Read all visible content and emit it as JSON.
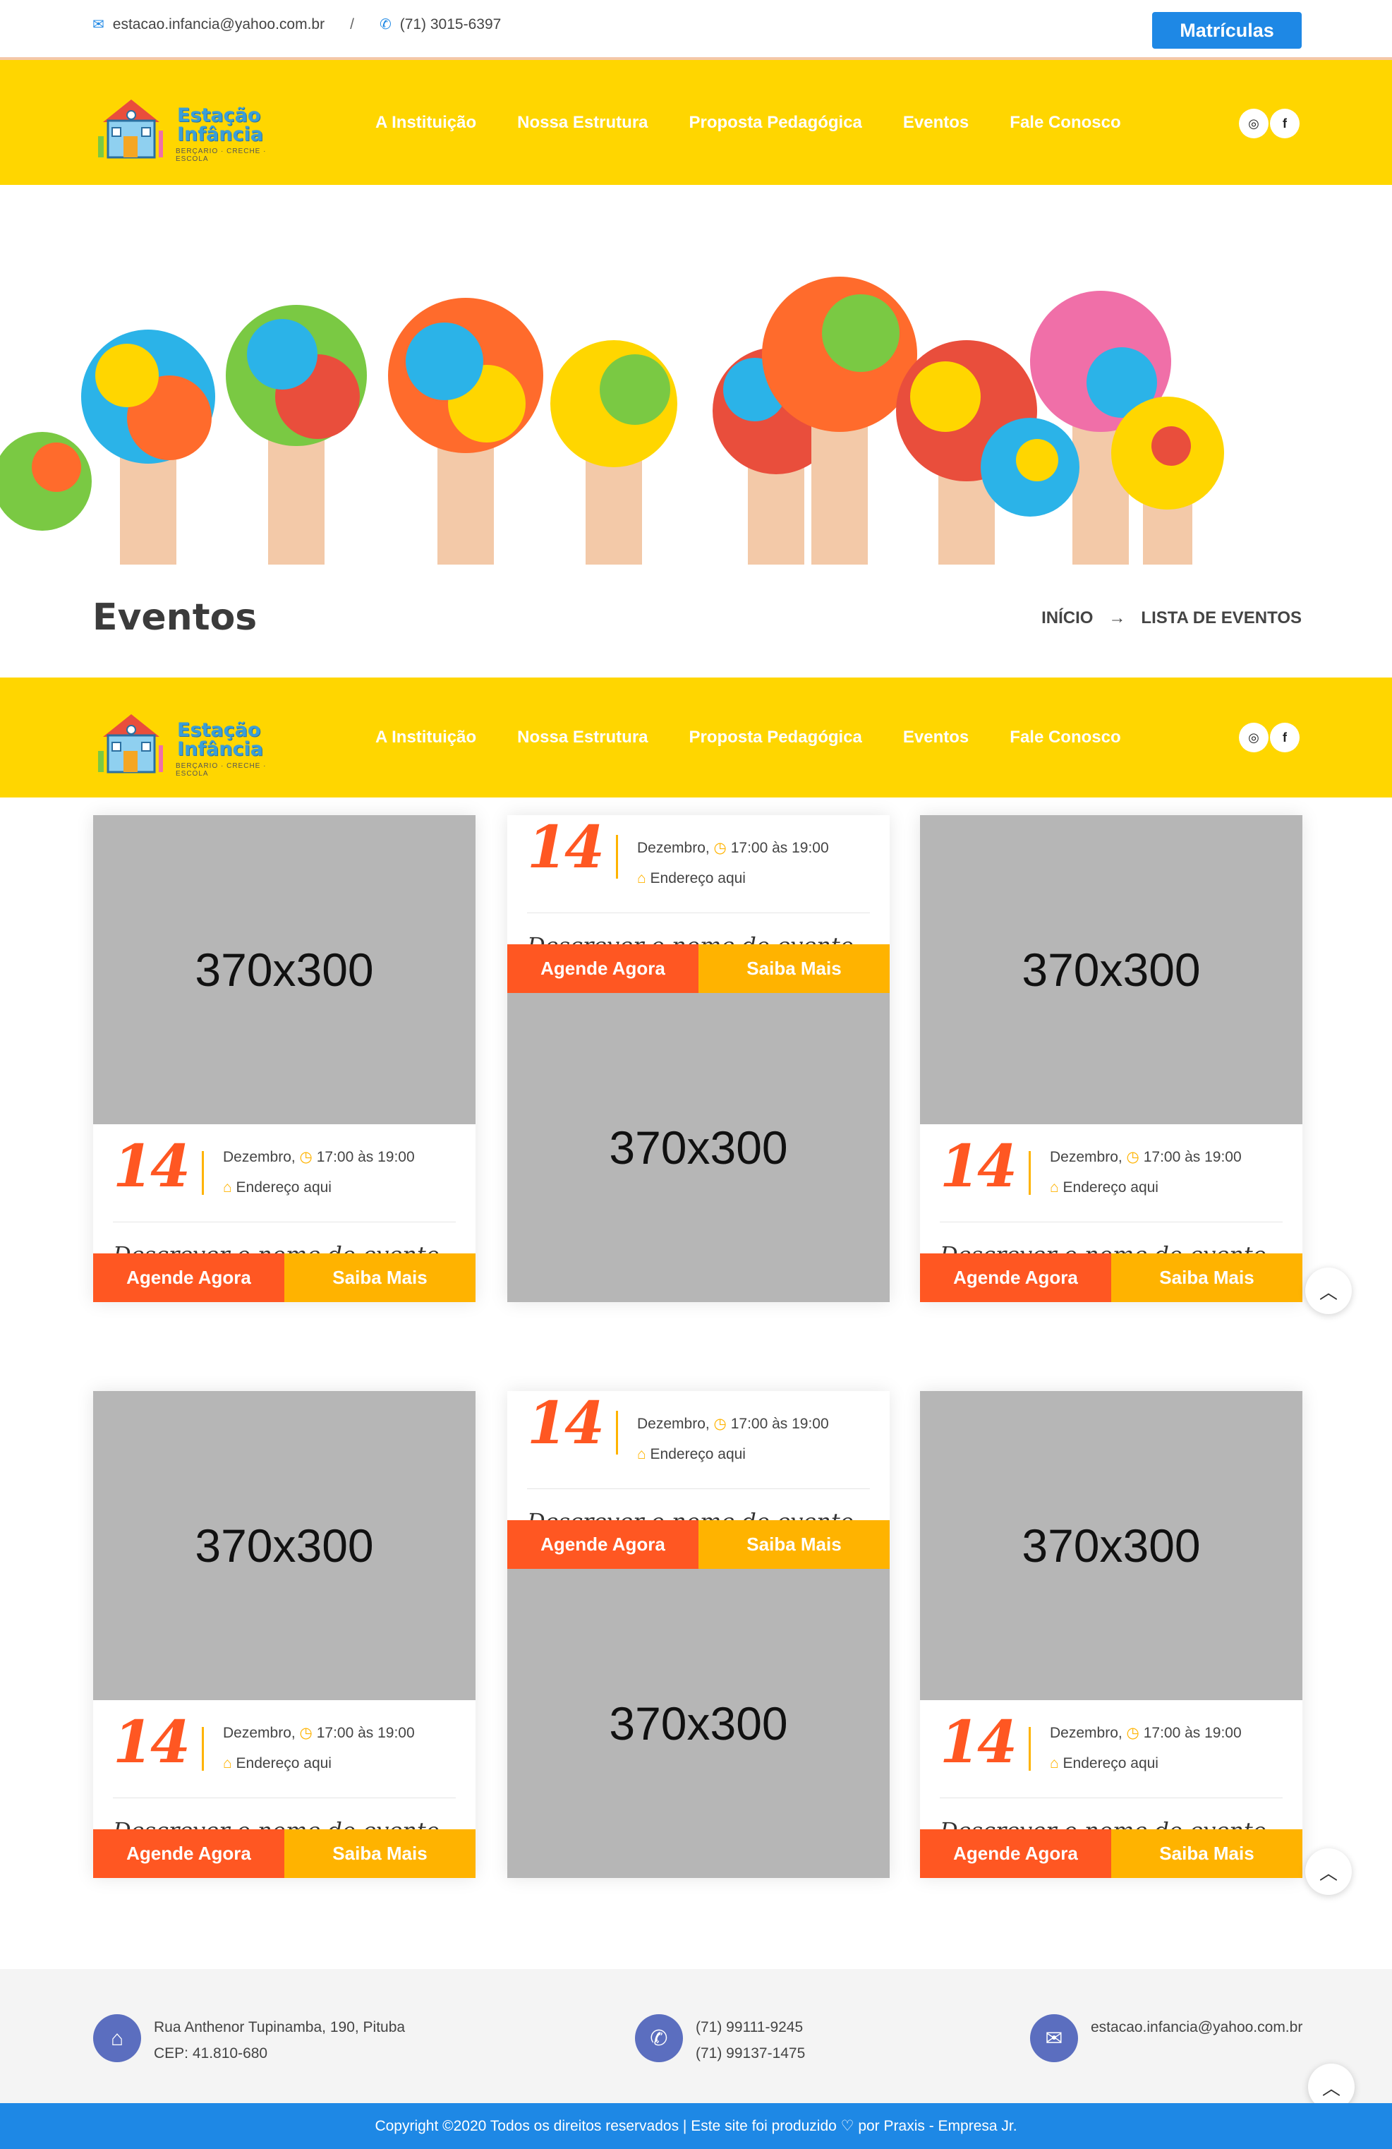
{
  "topbar": {
    "email": "estacao.infancia@yahoo.com.br",
    "separator": "/",
    "phone": "(71) 3015-6397",
    "cta": "Matrículas",
    "email_icon": "envelope-icon",
    "phone_icon": "phone-icon"
  },
  "logo": {
    "line1": "Estação",
    "line2": "Infância",
    "tagline": "BERÇARIO · CRECHE · ESCOLA"
  },
  "nav": {
    "items": [
      {
        "label": "A Instituição"
      },
      {
        "label": "Nossa Estrutura"
      },
      {
        "label": "Proposta Pedagógica"
      },
      {
        "label": "Eventos"
      },
      {
        "label": "Fale Conosco"
      }
    ],
    "social": [
      {
        "icon": "instagram-icon",
        "glyph": "◎"
      },
      {
        "icon": "facebook-icon",
        "glyph": "f"
      }
    ]
  },
  "page": {
    "title": "Eventos",
    "breadcrumb": [
      "INÍCIO",
      "→",
      "LISTA DE EVENTOS"
    ]
  },
  "events": [
    {
      "placeholder": "370x300",
      "day": "14",
      "month": "Dezembro,",
      "time": "17:00 às 19:00",
      "address": "Endereço aqui",
      "name": "Descrever o nome do evento",
      "btn_primary": "Agende Agora",
      "btn_secondary": "Saiba Mais"
    },
    {
      "placeholder": "370x300",
      "day": "14",
      "month": "Dezembro,",
      "time": "17:00 às 19:00",
      "address": "Endereço aqui",
      "name": "Descrever o nome do evento",
      "btn_primary": "Agende Agora",
      "btn_secondary": "Saiba Mais"
    },
    {
      "placeholder": "370x300",
      "day": "14",
      "month": "Dezembro,",
      "time": "17:00 às 19:00",
      "address": "Endereço aqui",
      "name": "Descrever o nome do evento",
      "btn_primary": "Agende Agora",
      "btn_secondary": "Saiba Mais"
    },
    {
      "placeholder": "370x300",
      "day": "14",
      "month": "Dezembro,",
      "time": "17:00 às 19:00",
      "address": "Endereço aqui",
      "name": "Descrever o nome do evento",
      "btn_primary": "Agende Agora",
      "btn_secondary": "Saiba Mais"
    },
    {
      "placeholder": "370x300",
      "day": "14",
      "month": "Dezembro,",
      "time": "17:00 às 19:00",
      "address": "Endereço aqui",
      "name": "Descrever o nome do evento",
      "btn_primary": "Agende Agora",
      "btn_secondary": "Saiba Mais"
    },
    {
      "placeholder": "370x300",
      "day": "14",
      "month": "Dezembro,",
      "time": "17:00 às 19:00",
      "address": "Endereço aqui",
      "name": "Descrever o nome do evento",
      "btn_primary": "Agende Agora",
      "btn_secondary": "Saiba Mais"
    }
  ],
  "footer": {
    "address_line1": "Rua Anthenor Tupinamba, 190, Pituba",
    "address_line2": "CEP: 41.810-680",
    "phone1": "(71) 99111-9245",
    "phone2": "(71) 99137-1475",
    "email": "estacao.infancia@yahoo.com.br",
    "copyright": "Copyright ©2020 Todos os direitos reservados | Este site foi produzido ♡  por Praxis - Empresa Jr."
  },
  "colors": {
    "nav_yellow": "#ffd600",
    "accent_blue": "#1e88e5",
    "btn_orange": "#ff5722",
    "btn_amber": "#ffb300"
  }
}
